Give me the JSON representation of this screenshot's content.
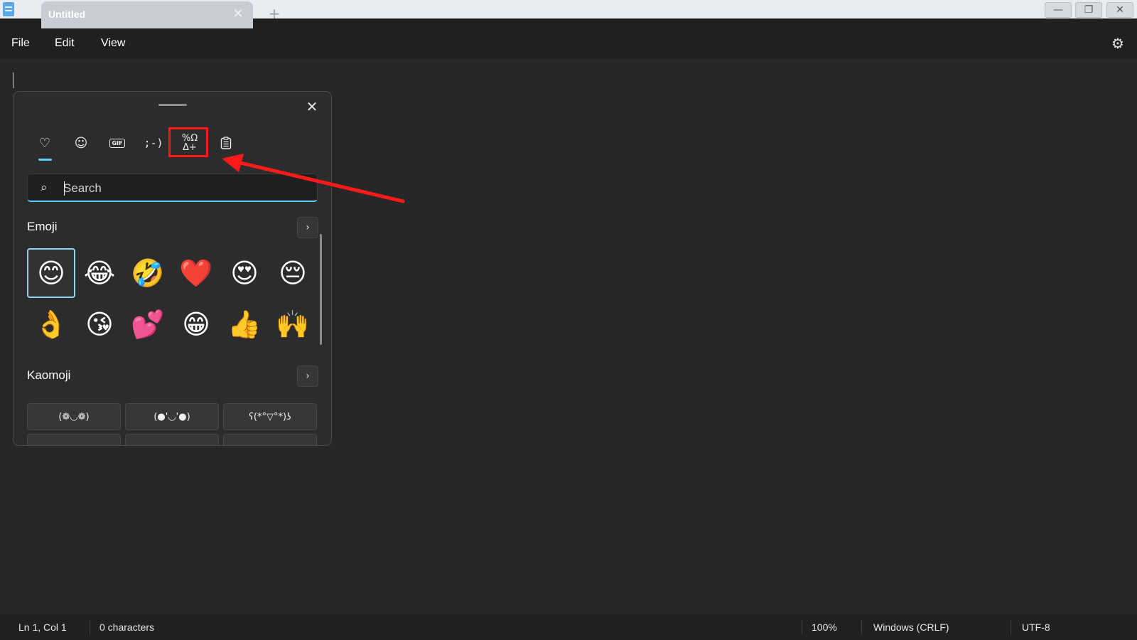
{
  "window": {
    "tab_title": "Untitled",
    "tab_close_glyph": "✕",
    "new_tab_glyph": "+",
    "minimize_glyph": "—",
    "maximize_glyph": "❐",
    "close_glyph": "✕"
  },
  "menu": {
    "file": "File",
    "edit": "Edit",
    "view": "View",
    "settings_glyph": "⚙"
  },
  "emoji_panel": {
    "close_glyph": "✕",
    "categories": [
      {
        "name": "favorites",
        "glyph": "♡"
      },
      {
        "name": "emoji",
        "glyph": "☺"
      },
      {
        "name": "gif",
        "glyph": "GIF"
      },
      {
        "name": "kaomoji",
        "glyph": ";-)"
      },
      {
        "name": "symbols",
        "glyph": "%Ω\nΔ+"
      },
      {
        "name": "clipboard",
        "glyph": "📋"
      }
    ],
    "search": {
      "placeholder": "Search",
      "value": "",
      "icon": "⌕"
    },
    "emoji_section": {
      "label": "Emoji",
      "more_glyph": "›",
      "items": [
        "😊",
        "😂",
        "🤣",
        "❤️",
        "😍",
        "😔",
        "👌",
        "😘",
        "💕",
        "😁",
        "👍",
        "🙌"
      ]
    },
    "kaomoji_section": {
      "label": "Kaomoji",
      "more_glyph": "›",
      "items": [
        "(❁◡❁)",
        "(●'◡'●)",
        "ʕ(*°▽°*)ʖ"
      ]
    }
  },
  "status": {
    "position": "Ln 1, Col 1",
    "characters": "0 characters",
    "zoom": "100%",
    "line_endings": "Windows (CRLF)",
    "encoding": "UTF-8"
  },
  "colors": {
    "accent": "#60cdff",
    "annotation": "#ff1a1a",
    "background": "#272727"
  }
}
